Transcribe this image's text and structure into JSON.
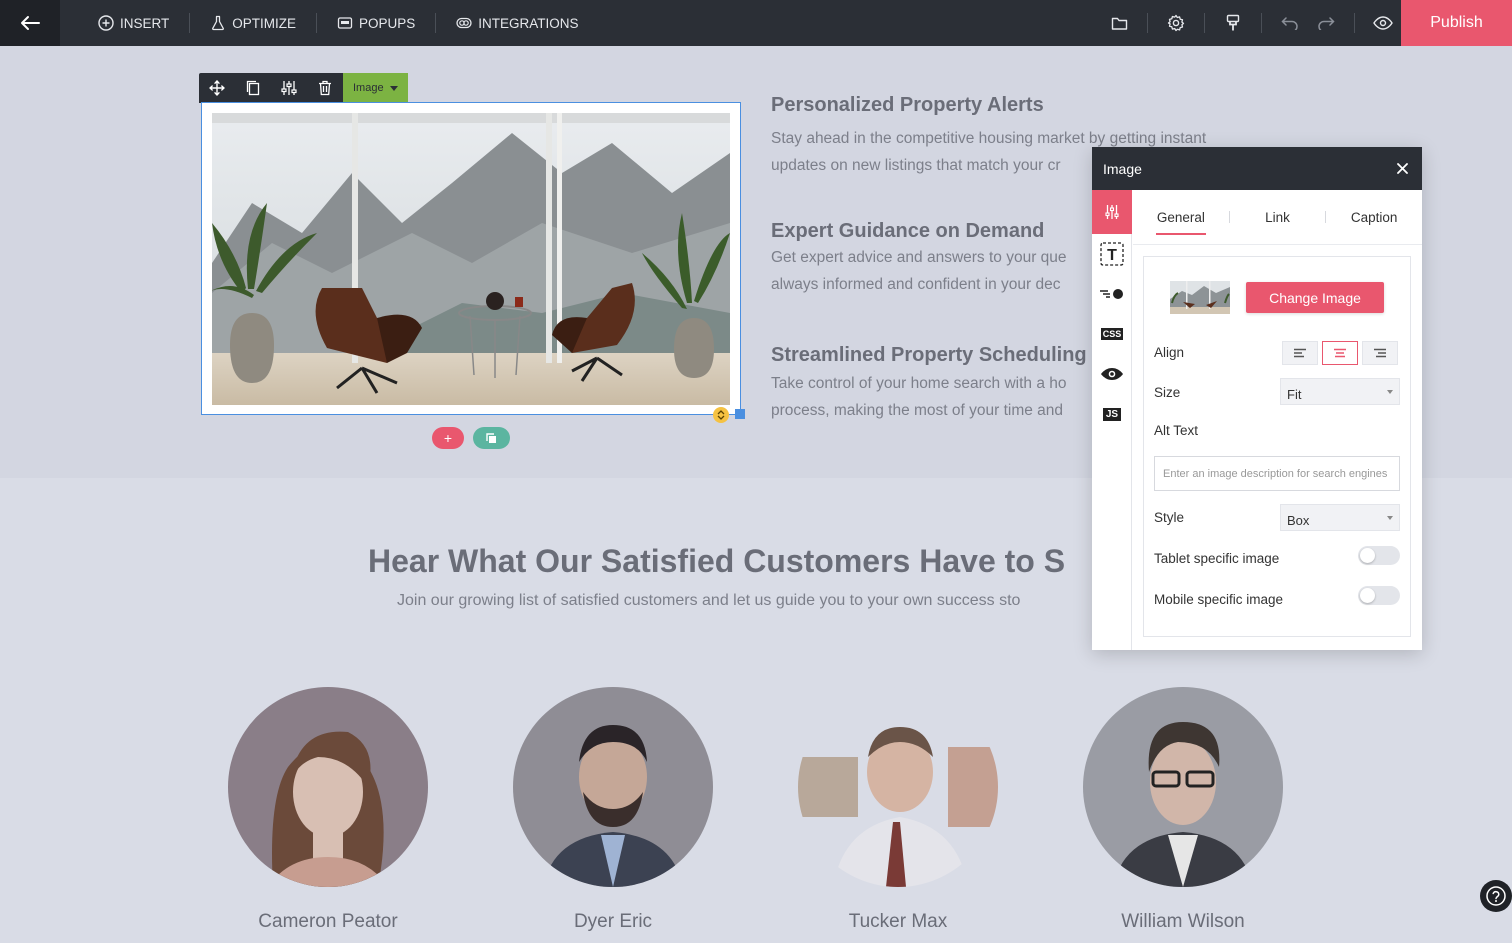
{
  "topbar": {
    "nav": [
      {
        "label": "INSERT",
        "icon": "plus-circle-icon"
      },
      {
        "label": "OPTIMIZE",
        "icon": "flask-icon"
      },
      {
        "label": "POPUPS",
        "icon": "popup-icon"
      },
      {
        "label": "INTEGRATIONS",
        "icon": "integrations-icon"
      }
    ],
    "tools": [
      "folder-icon",
      "gear-icon",
      "paint-brush-icon",
      "undo-icon",
      "redo-icon",
      "eye-icon"
    ],
    "publish_label": "Publish"
  },
  "element_toolbar": {
    "type_label": "Image",
    "tools": [
      "move-icon",
      "copy-icon",
      "settings-sliders-icon",
      "trash-icon"
    ]
  },
  "features": [
    {
      "title": "Personalized Property Alerts",
      "lines": [
        "Stay ahead in the competitive housing market by getting instant",
        "updates on new listings that match your cr"
      ]
    },
    {
      "title": "Expert Guidance on Demand",
      "lines": [
        "Get expert advice and answers to your que",
        "always informed and confident in your dec"
      ]
    },
    {
      "title": "Streamlined Property Scheduling",
      "lines": [
        "Take control of your home search with a ho",
        "process, making the most of your time and"
      ]
    }
  ],
  "testimonials": {
    "title": "Hear What Our Satisfied Customers Have to S",
    "subtitle": "Join our growing list of satisfied customers and let us guide you to your own success sto",
    "customers": [
      {
        "name": "Cameron Peator"
      },
      {
        "name": "Dyer Eric"
      },
      {
        "name": "Tucker Max"
      },
      {
        "name": "William Wilson"
      }
    ]
  },
  "panel": {
    "title": "Image",
    "tabs": [
      "General",
      "Link",
      "Caption"
    ],
    "active_tab": "General",
    "sidebar": [
      "sliders-icon",
      "text-icon",
      "animation-icon",
      "css-icon",
      "eye-icon",
      "js-icon"
    ],
    "css_label": "CSS",
    "js_label": "JS",
    "text_label": "T",
    "change_image_label": "Change Image",
    "align_label": "Align",
    "size_label": "Size",
    "size_value": "Fit",
    "alt_text_label": "Alt Text",
    "alt_placeholder": "Enter an image description for search engines",
    "style_label": "Style",
    "style_value": "Box",
    "tablet_label": "Tablet specific image",
    "mobile_label": "Mobile specific image"
  },
  "colors": {
    "accent": "#e9576e",
    "topbar": "#2b2f36",
    "selection": "#4a8fe0",
    "element_tag": "#7cb342"
  }
}
